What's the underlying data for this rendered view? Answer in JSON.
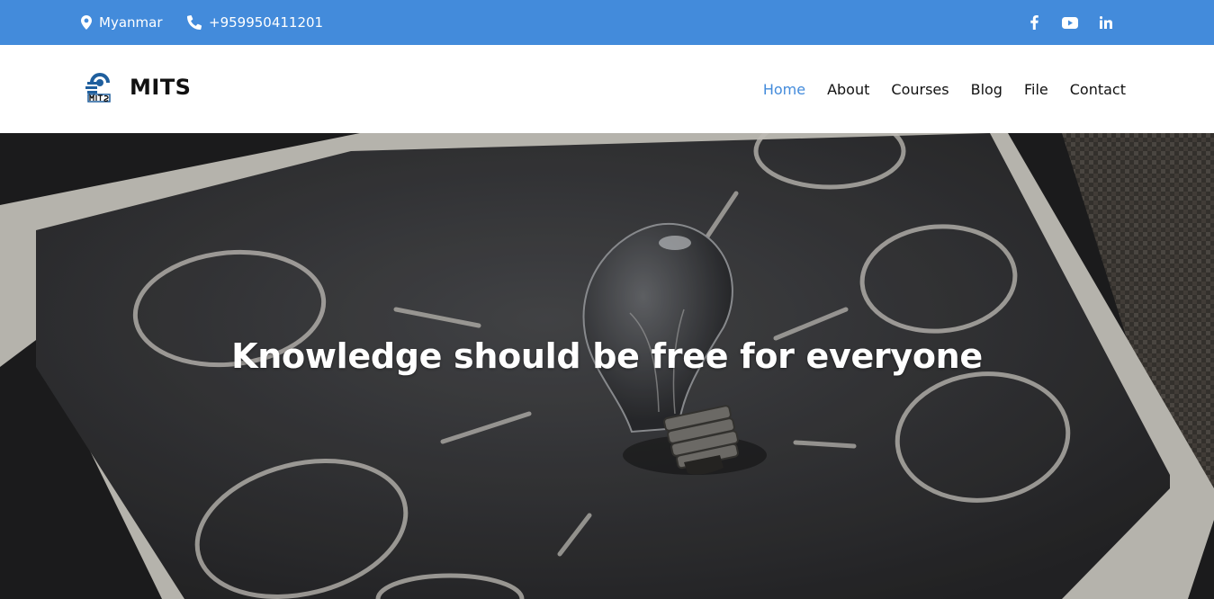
{
  "topbar": {
    "location": "Myanmar",
    "phone": "+959950411201",
    "social": [
      {
        "icon": "facebook-icon"
      },
      {
        "icon": "youtube-icon"
      },
      {
        "icon": "linkedin-icon"
      }
    ],
    "background": "#438bdb"
  },
  "navbar": {
    "brand": "MITS",
    "menu": [
      "Home",
      "About",
      "Courses",
      "Blog",
      "File",
      "Contact"
    ],
    "active": "Home",
    "accent": "#438bdb"
  },
  "hero": {
    "title": "Knowledge should be free for everyone",
    "image": "lightbulb-chalkboard-background"
  }
}
